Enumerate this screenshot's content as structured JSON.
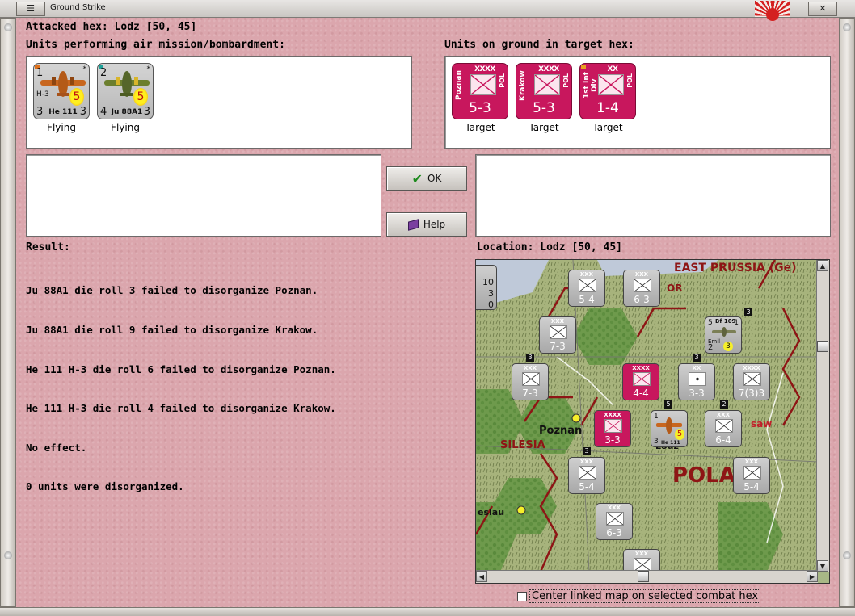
{
  "window": {
    "title": "Ground Strike"
  },
  "header": {
    "attacked_hex": "Attacked hex: Lodz  [50, 45]",
    "air_units_label": "Units performing air mission/bombardment:",
    "ground_units_label": "Units on ground in target hex:"
  },
  "air_units": [
    {
      "model": "He 111",
      "sub": "H-3",
      "top_num": "1",
      "left_num": "3",
      "right_num": "3",
      "rating": "5",
      "star": "*",
      "status": "Flying",
      "color": "#c8661e"
    },
    {
      "model": "Ju 88A1",
      "sub": "",
      "top_num": "2",
      "left_num": "4",
      "right_num": "3",
      "rating": "5",
      "star": "*",
      "status": "Flying",
      "color": "#6c7f2e"
    }
  ],
  "ground_units": [
    {
      "name": "Poznan",
      "size": "XXXX",
      "nation": "POL",
      "strength": "5-3",
      "status": "Target"
    },
    {
      "name": "Krakow",
      "size": "XXXX",
      "nation": "POL",
      "strength": "5-3",
      "status": "Target"
    },
    {
      "name": "1st Inf Div",
      "size": "XX",
      "nation": "POL",
      "strength": "1-4",
      "status": "Target"
    }
  ],
  "buttons": {
    "ok": "OK",
    "help": "Help"
  },
  "result": {
    "label": "Result:",
    "lines": [
      "Ju 88A1 die roll 3 failed to disorganize Poznan.",
      "Ju 88A1 die roll 9 failed to disorganize Krakow.",
      "He 111 H-3 die roll 6 failed to disorganize Poznan.",
      "He 111 H-3 die roll 4 failed to disorganize Krakow.",
      "No effect.",
      "0 units were disorganized."
    ]
  },
  "location": {
    "label": "Location:  Lodz  [50, 45]"
  },
  "map": {
    "place_labels": [
      "EAST PRUSSIA (Ge)",
      "Poznan",
      "SILESIA",
      "POLA",
      "Lodz",
      "eslau",
      "saw",
      "OR"
    ],
    "counters": [
      {
        "strength": "5-4",
        "size": "XXX",
        "type": "gray"
      },
      {
        "strength": "6-3",
        "size": "XXX",
        "type": "gray"
      },
      {
        "strength": "7-3",
        "size": "XXX",
        "type": "gray"
      },
      {
        "strength": "7-3",
        "size": "XXX",
        "type": "gray"
      },
      {
        "strength": "4-4",
        "size": "XXXX",
        "type": "pol"
      },
      {
        "strength": "3-3",
        "size": "XX",
        "type": "gray"
      },
      {
        "strength": "7(3)3",
        "size": "XXXX",
        "type": "gray"
      },
      {
        "strength": "3-3",
        "size": "XXXX",
        "type": "pol"
      },
      {
        "strength": "6-4",
        "size": "XXX",
        "type": "gray"
      },
      {
        "strength": "5-4",
        "size": "XXX",
        "type": "gray"
      },
      {
        "strength": "5-4",
        "size": "XXX",
        "type": "gray"
      },
      {
        "strength": "6-3",
        "size": "XXX",
        "type": "gray"
      },
      {
        "strength": "",
        "size": "XXX",
        "type": "gray"
      }
    ],
    "stack_badges": [
      "3",
      "3",
      "3",
      "5",
      "2",
      "3"
    ],
    "air_counter": {
      "model": "Bf 109",
      "sub": "Emil",
      "left": "5",
      "right": "1",
      "bottom_left": "2",
      "rating": "3"
    },
    "map_air_he111": {
      "model": "He 111",
      "left": "1",
      "bottom_left": "3",
      "rating": "5"
    },
    "edge_counter": {
      "nums": [
        "10",
        "3",
        "0"
      ]
    }
  },
  "checkbox": {
    "label": "Center linked map on selected combat hex",
    "checked": false
  }
}
